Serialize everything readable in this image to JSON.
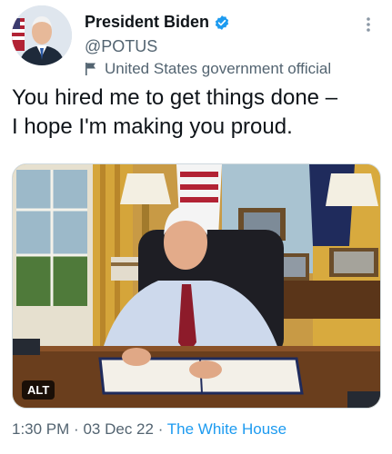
{
  "author": {
    "display_name": "President Biden",
    "handle": "@POTUS",
    "label": "United States government official",
    "verified_color": "#1d9bf0"
  },
  "tweet": {
    "text": "You hired me to get things done –\nI hope I'm making you proud."
  },
  "media": {
    "alt_badge": "ALT"
  },
  "meta": {
    "time": "1:30 PM",
    "separator": "·",
    "date": "03 Dec 22",
    "source": "The White House"
  },
  "icons": {
    "more": "more-vertical-icon",
    "verified": "verified-badge-icon",
    "label": "flag-icon"
  },
  "colors": {
    "text": "#0f1419",
    "secondary": "#536471",
    "link": "#1d9bf0"
  }
}
